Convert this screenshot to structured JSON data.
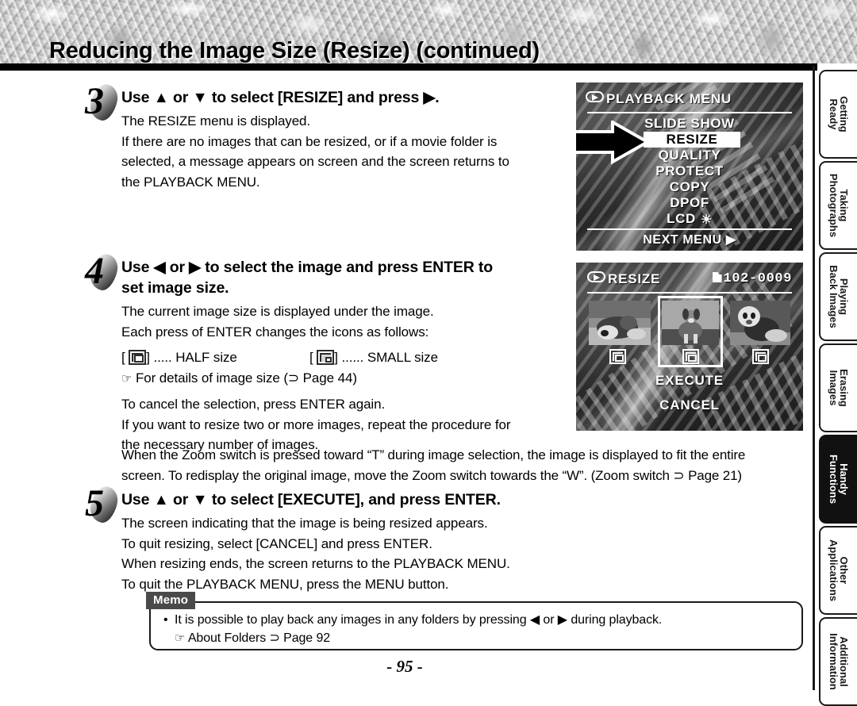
{
  "header": {
    "title": "Reducing the Image Size (Resize) (continued)"
  },
  "side_tabs": [
    {
      "line1": "Getting",
      "line2": "Ready",
      "active": false
    },
    {
      "line1": "Taking",
      "line2": "Photographs",
      "active": false
    },
    {
      "line1": "Playing",
      "line2": "Back Images",
      "active": false
    },
    {
      "line1": "Erasing",
      "line2": "Images",
      "active": false
    },
    {
      "line1": "Handy",
      "line2": "Functions",
      "active": true
    },
    {
      "line1": "Other",
      "line2": "Applications",
      "active": false
    },
    {
      "line1": "Additional",
      "line2": "Information",
      "active": false
    }
  ],
  "steps": [
    {
      "number": "3",
      "heading": "Use ▲ or ▼ to select [RESIZE] and press ▶.",
      "lines": [
        "The RESIZE menu is displayed.",
        "If there are no images that can be resized, or if a movie folder is",
        "selected, a message appears on screen and the screen returns to",
        "the PLAYBACK MENU."
      ]
    },
    {
      "number": "4",
      "heading_line1": "Use ◀ or ▶ to select the image and press ENTER to",
      "heading_line2": "set image size.",
      "lines": [
        "The current image size is displayed under the image.",
        "Each press of ENTER changes the icons as follows:"
      ],
      "size_half_prefix": "[",
      "size_half_suffix": "] ..... HALF size",
      "size_small_prefix": "[",
      "size_small_suffix": "] ...... SMALL size",
      "ref_line": "For details of image size (⊃ Page 44)",
      "ref_icon": "pointing-hand-icon",
      "more_lines": [
        "To cancel the selection, press ENTER again.",
        "If you want to resize two or more images, repeat the procedure for",
        "the necessary number of images."
      ]
    },
    {
      "number": "5",
      "heading": "Use ▲ or ▼ to select [EXECUTE], and press ENTER.",
      "lines": [
        "The screen indicating that the image is being resized appears.",
        "To quit resizing, select [CANCEL] and press ENTER.",
        "When resizing ends, the screen returns to the PLAYBACK MENU.",
        "To quit the PLAYBACK MENU, press the MENU button."
      ]
    }
  ],
  "wide_paragraph": [
    "When the Zoom switch is pressed toward “T” during image selection, the image is displayed to fit the entire",
    "screen. To redisplay the original image, move the Zoom switch towards the “W”.  (Zoom switch ⊃ Page 21)"
  ],
  "memo": {
    "tag": "Memo",
    "bullet_line": "It is possible to play back any images in any folders by pressing ◀ or ▶ during playback.",
    "ref_line": "About Folders ⊃ Page 92",
    "ref_icon": "pointing-hand-icon"
  },
  "page_number": "- 95 -",
  "lcd_playback_menu": {
    "title": "PLAYBACK MENU",
    "title_icon": "playback-badge-icon",
    "items": [
      {
        "label": "SLIDE SHOW",
        "selected": false
      },
      {
        "label": "RESIZE",
        "selected": true
      },
      {
        "label": "QUALITY",
        "selected": false
      },
      {
        "label": "PROTECT",
        "selected": false
      },
      {
        "label": "COPY",
        "selected": false
      },
      {
        "label": "DPOF",
        "selected": false
      },
      {
        "label": "LCD",
        "selected": false,
        "trailing_icon": "sun-brightness-icon"
      }
    ],
    "next_menu": "NEXT MENU ▶",
    "callout_icon": "black-pointer-arrow-icon"
  },
  "lcd_resize_screen": {
    "title": "RESIZE",
    "title_icon": "playback-badge-icon",
    "file_number": "102-0009",
    "file_icon": "folder-icon",
    "thumbnails": [
      {
        "name": "thumbnail-left",
        "selected": false,
        "size_icon": "half-size-icon"
      },
      {
        "name": "thumbnail-center",
        "selected": true,
        "size_icon": "half-size-icon"
      },
      {
        "name": "thumbnail-right",
        "selected": false,
        "size_icon": "half-size-icon"
      }
    ],
    "execute_label": "EXECUTE",
    "cancel_label": "CANCEL"
  }
}
